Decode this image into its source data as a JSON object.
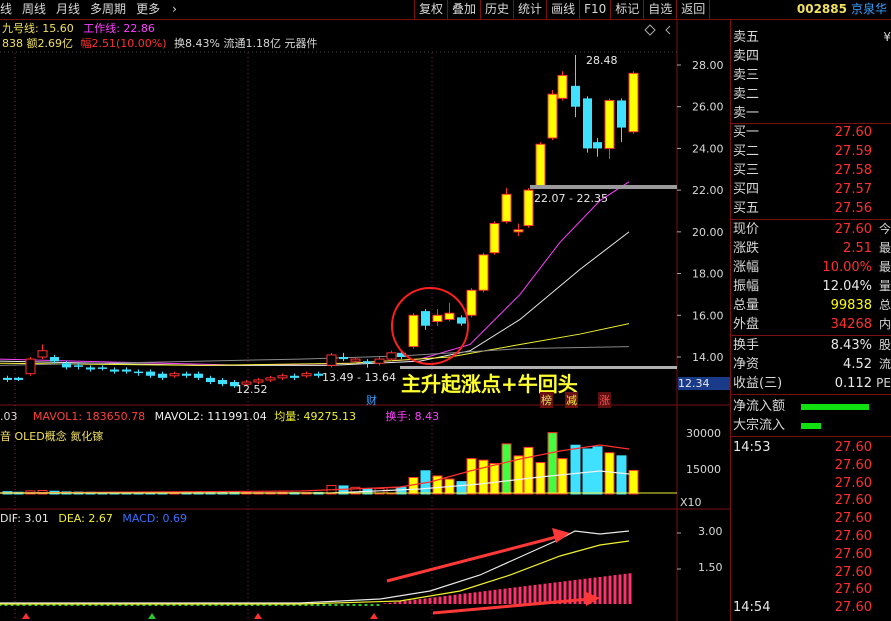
{
  "toolbar": {
    "left_items": [
      "线",
      "周线",
      "月线",
      "多周期",
      "更多"
    ],
    "right_buttons": [
      "复权",
      "叠加",
      "历史",
      "统计",
      "画线",
      "F10",
      "标记",
      "自选",
      "返回"
    ],
    "stock_code": "002885",
    "stock_name": "京泉华"
  },
  "info": {
    "line1_a": "九号线: 15.60",
    "line1_b": "工作线: 22.86",
    "line2_a": "838 额2.69亿",
    "line2_b": "幅2.51(10.00%)",
    "line2_c": "换8.43% 流通1.18亿 元器件"
  },
  "annotations": {
    "high": "28.48",
    "resist_range": "22.07 - 22.35",
    "low": "12.52",
    "range2": "13.49 - 13.64",
    "headline": "主升起涨点+牛回头",
    "cai": "财",
    "bang": "榜",
    "jian": "减",
    "zhang": "涨",
    "cur_price_tag": "12.34"
  },
  "volume": {
    "l1": ".03",
    "mavol1": "MAVOL1: 183650.78",
    "mavol2": "MAVOL2: 111991.04",
    "junliang": "均量: 49275.13",
    "huanshou": "换手: 8.43",
    "concept": "音 OLED概念 氮化镓",
    "axis": [
      "30000",
      "15000"
    ],
    "unit": "X10"
  },
  "macd": {
    "dif": "DIF: 3.01",
    "dea": "DEA: 2.67",
    "macd": "MACD: 0.69",
    "axis": [
      "3.00",
      "1.50"
    ]
  },
  "price_axis": [
    "28.00",
    "26.00",
    "24.00",
    "22.00",
    "20.00",
    "18.00",
    "16.00",
    "14.00"
  ],
  "panel": {
    "sell": [
      {
        "label": "卖五",
        "value": "",
        "tail": "¥"
      },
      {
        "label": "卖四",
        "value": "",
        "tail": ""
      },
      {
        "label": "卖三",
        "value": "",
        "tail": ""
      },
      {
        "label": "卖二",
        "value": "",
        "tail": ""
      },
      {
        "label": "卖一",
        "value": "",
        "tail": ""
      }
    ],
    "buy": [
      {
        "label": "买一",
        "value": "27.60"
      },
      {
        "label": "买二",
        "value": "27.59"
      },
      {
        "label": "买三",
        "value": "27.58"
      },
      {
        "label": "买四",
        "value": "27.57"
      },
      {
        "label": "买五",
        "value": "27.56"
      }
    ],
    "stats": [
      {
        "label": "现价",
        "value": "27.60",
        "tail": "今",
        "color": "red"
      },
      {
        "label": "涨跌",
        "value": "2.51",
        "tail": "最",
        "color": "red"
      },
      {
        "label": "涨幅",
        "value": "10.00%",
        "tail": "最",
        "color": "red"
      },
      {
        "label": "振幅",
        "value": "12.04%",
        "tail": "量",
        "color": "wht"
      },
      {
        "label": "总量",
        "value": "99838",
        "tail": "总",
        "color": "yel"
      },
      {
        "label": "外盘",
        "value": "34268",
        "tail": "内",
        "color": "red"
      }
    ],
    "stats2": [
      {
        "label": "换手",
        "value": "8.43%",
        "tail": "股",
        "color": "wht"
      },
      {
        "label": "净资",
        "value": "4.52",
        "tail": "流",
        "color": "wht"
      },
      {
        "label": "收益(三)",
        "value": "0.112",
        "tail": "PE",
        "color": "wht"
      }
    ],
    "flow": [
      {
        "label": "净流入额"
      },
      {
        "label": "大宗流入"
      }
    ],
    "ticks": [
      {
        "time": "14:53",
        "price": "27.60"
      },
      {
        "time": "",
        "price": "27.60"
      },
      {
        "time": "",
        "price": "27.60"
      },
      {
        "time": "",
        "price": "27.60"
      },
      {
        "time": "",
        "price": "27.60"
      },
      {
        "time": "",
        "price": "27.60"
      },
      {
        "time": "",
        "price": "27.60"
      },
      {
        "time": "",
        "price": "27.60"
      },
      {
        "time": "",
        "price": "27.60"
      },
      {
        "time": "14:54",
        "price": "27.60"
      }
    ]
  }
}
